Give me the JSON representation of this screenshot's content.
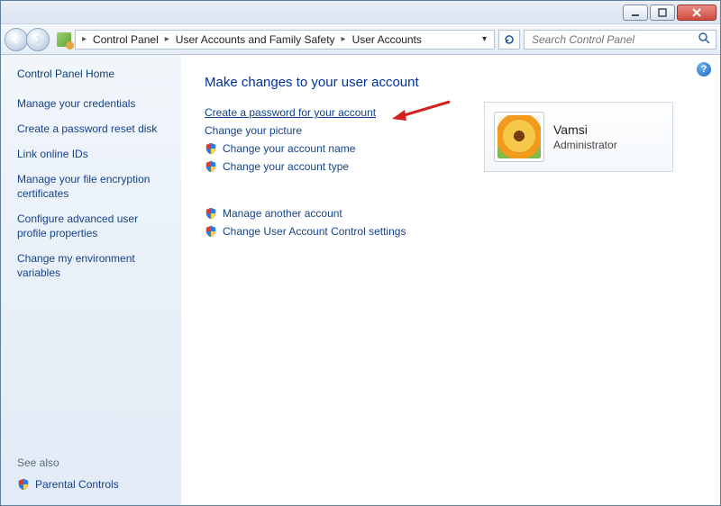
{
  "titlebar": {},
  "toolbar": {
    "breadcrumb": {
      "seg1": "Control Panel",
      "seg2": "User Accounts and Family Safety",
      "seg3": "User Accounts"
    },
    "search_placeholder": "Search Control Panel"
  },
  "sidebar": {
    "home": "Control Panel Home",
    "links": [
      "Manage your credentials",
      "Create a password reset disk",
      "Link online IDs",
      "Manage your file encryption certificates",
      "Configure advanced user profile properties",
      "Change my environment variables"
    ],
    "see_also": "See also",
    "parental": "Parental Controls"
  },
  "main": {
    "heading": "Make changes to your user account",
    "tasks_top": [
      {
        "shield": false,
        "label": "Create a password for your account",
        "highlight": true
      },
      {
        "shield": false,
        "label": "Change your picture",
        "highlight": false
      },
      {
        "shield": true,
        "label": "Change your account name",
        "highlight": false
      },
      {
        "shield": true,
        "label": "Change your account type",
        "highlight": false
      }
    ],
    "tasks_bottom": [
      {
        "shield": true,
        "label": "Manage another account"
      },
      {
        "shield": true,
        "label": "Change User Account Control settings"
      }
    ]
  },
  "account": {
    "name": "Vamsi",
    "role": "Administrator"
  }
}
